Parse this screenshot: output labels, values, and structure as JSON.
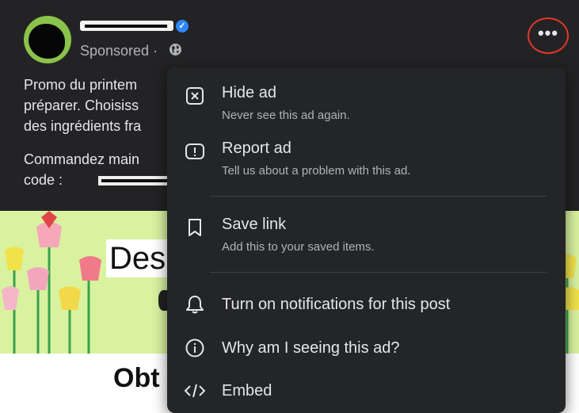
{
  "post": {
    "sponsored_label": "Sponsored ·",
    "verified_glyph": "✓",
    "more_glyph": "•••",
    "body_lines": [
      "Promo du printem",
      "préparer. Choisiss",
      "des ingrédients fra"
    ],
    "body_lines_2": [
      "Commandez main",
      "code :"
    ],
    "banner_word": "Des",
    "bottom_word": "Obt"
  },
  "menu": {
    "items": [
      {
        "label": "Hide ad",
        "sub": "Never see this ad again.",
        "icon": "hide-icon"
      },
      {
        "label": "Report ad",
        "sub": "Tell us about a problem with this ad.",
        "icon": "report-icon"
      },
      {
        "label": "Save link",
        "sub": "Add this to your saved items.",
        "icon": "bookmark-icon"
      },
      {
        "label": "Turn on notifications for this post",
        "icon": "bell-icon"
      },
      {
        "label": "Why am I seeing this ad?",
        "icon": "info-icon"
      },
      {
        "label": "Embed",
        "icon": "embed-icon"
      }
    ]
  },
  "colors": {
    "menu_bg": "#242526",
    "post_bg": "#232325",
    "text_primary": "#e4e6eb",
    "text_secondary": "#b0b3b8",
    "highlight_ring": "#e0382b",
    "verified": "#2d88ff"
  }
}
